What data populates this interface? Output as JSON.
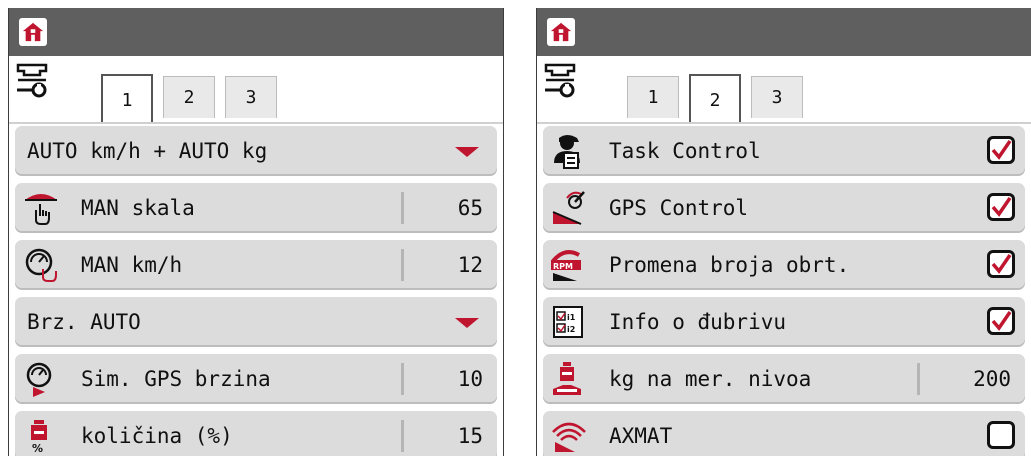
{
  "colors": {
    "accent_red": "#c0152f",
    "topbar": "#5f5f5f",
    "row_bg": "#dcdcdc"
  },
  "left": {
    "tabs": [
      "1",
      "2",
      "3"
    ],
    "active_tab": "1",
    "rows": [
      {
        "kind": "dropdown",
        "label": "AUTO km/h + AUTO kg"
      },
      {
        "kind": "value",
        "icon": "scale-hand-icon",
        "label": "MAN skala",
        "value": "65"
      },
      {
        "kind": "value",
        "icon": "speedometer-hand-icon",
        "label": "MAN km/h",
        "value": "12"
      },
      {
        "kind": "dropdown",
        "label": "Brz. AUTO"
      },
      {
        "kind": "value",
        "icon": "gps-speed-icon",
        "label": "Sim. GPS brzina",
        "value": "10"
      },
      {
        "kind": "value",
        "icon": "quantity-percent-icon",
        "label": "količina (%)",
        "value": "15"
      }
    ]
  },
  "right": {
    "tabs": [
      "1",
      "2",
      "3"
    ],
    "active_tab": "2",
    "rows": [
      {
        "kind": "check",
        "icon": "operator-icon",
        "label": "Task Control",
        "checked": true
      },
      {
        "kind": "check",
        "icon": "gps-control-icon",
        "label": "GPS Control",
        "checked": true
      },
      {
        "kind": "check",
        "icon": "rpm-icon",
        "label": "Promena broja obrt.",
        "checked": true
      },
      {
        "kind": "check",
        "icon": "fertilizer-info-icon",
        "label": "Info o đubrivu",
        "checked": true
      },
      {
        "kind": "value",
        "icon": "level-kg-icon",
        "label": "kg na mer. nivoa",
        "value": "200"
      },
      {
        "kind": "check",
        "icon": "axmat-icon",
        "label": "AXMAT",
        "checked": false
      }
    ]
  }
}
